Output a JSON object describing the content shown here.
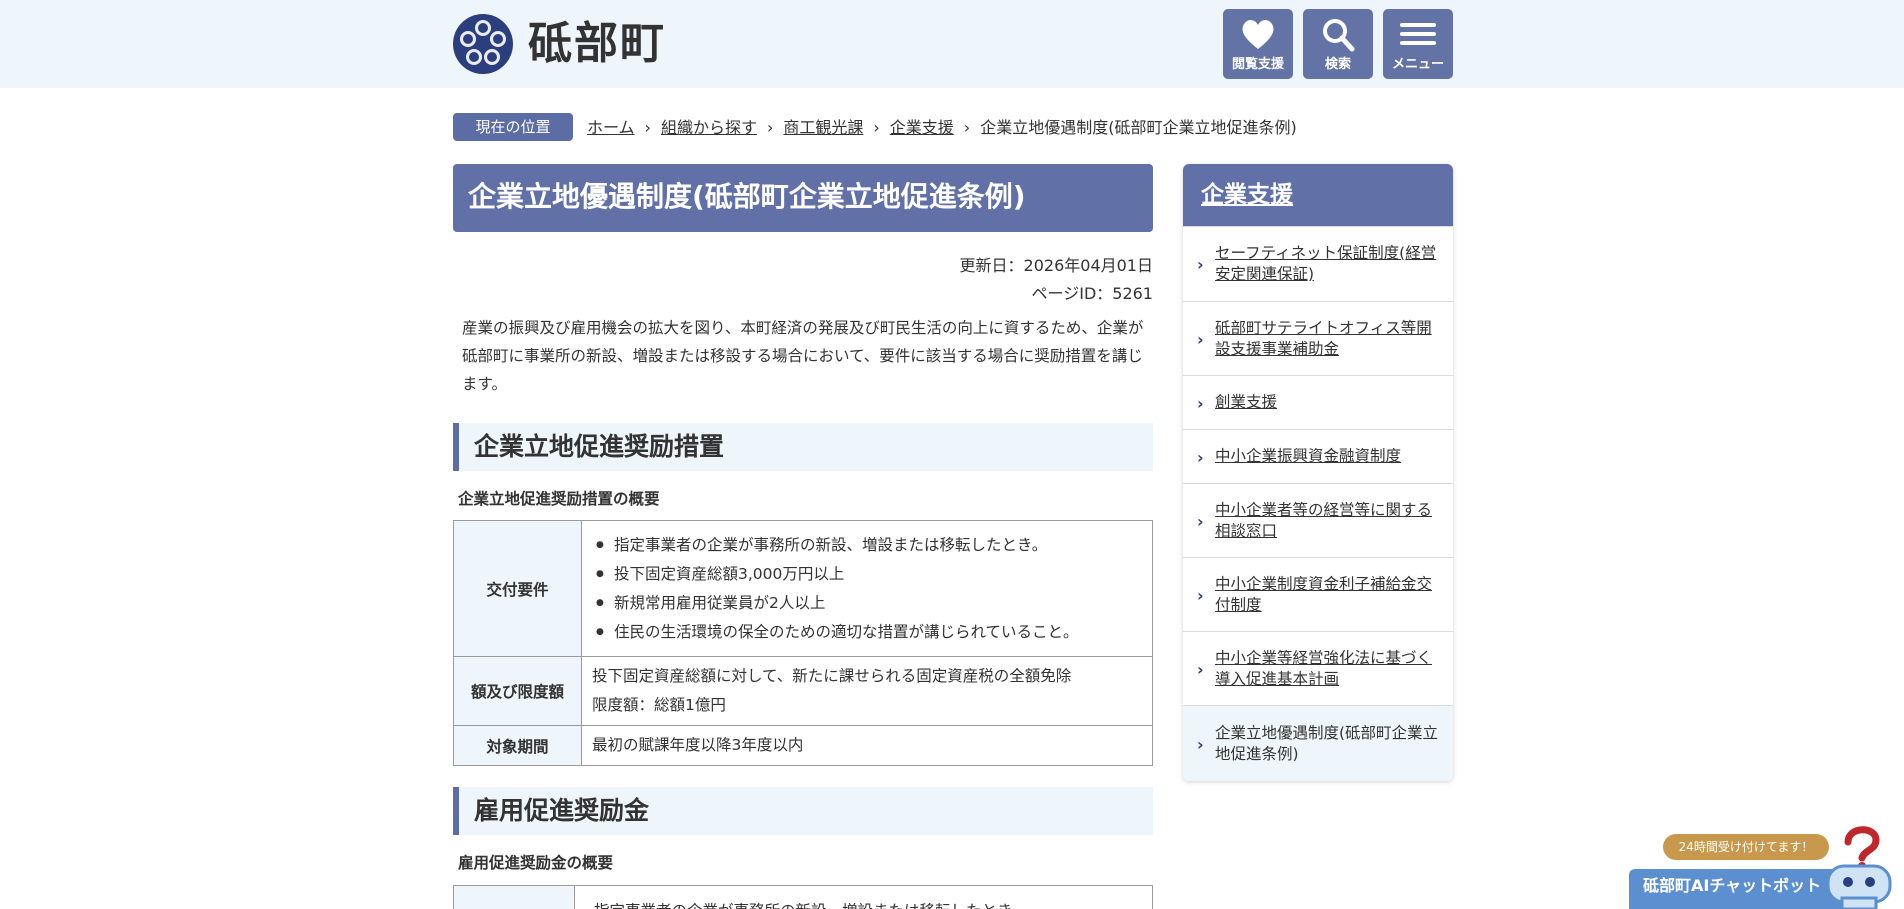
{
  "header": {
    "site_title": "砥部町",
    "buttons": [
      {
        "label": "閲覧支援",
        "icon": "heart-icon"
      },
      {
        "label": "検索",
        "icon": "search-icon"
      },
      {
        "label": "メニュー",
        "icon": "menu-icon"
      }
    ]
  },
  "breadcrumb": {
    "tag": "現在の位置",
    "items": [
      "ホーム",
      "組織から探す",
      "商工観光課",
      "企業支援"
    ],
    "current": "企業立地優遇制度(砥部町企業立地促進条例)",
    "separator": "›"
  },
  "main": {
    "title": "企業立地優遇制度(砥部町企業立地促進条例)",
    "updated": "更新日：2026年04月01日",
    "page_id": "ページID：5261",
    "intro": "産業の振興及び雇用機会の拡大を図り、本町経済の発展及び町民生活の向上に資するため、企業が砥部町に事業所の新設、増設または移設する場合において、要件に該当する場合に奨励措置を講じます。",
    "section1": {
      "heading": "企業立地促進奨励措置",
      "subheading": "企業立地促進奨励措置の概要",
      "rows": [
        {
          "label": "交付要件",
          "items": [
            "指定事業者の企業が事務所の新設、増設または移転したとき。",
            "投下固定資産総額3,000万円以上",
            "新規常用雇用従業員が2人以上",
            "住民の生活環境の保全のための適切な措置が講じられていること。"
          ]
        },
        {
          "label": "額及び限度額",
          "line1": "投下固定資産総額に対して、新たに課せられる固定資産税の全額免除",
          "line2": "限度額：総額1億円"
        },
        {
          "label": "対象期間",
          "line1": "最初の賦課年度以降3年度以内"
        }
      ]
    },
    "section2": {
      "heading": "雇用促進奨励金",
      "subheading": "雇用促進奨励金の概要",
      "first_line_partial": "指定事業者の企業が事務所の新設、増設または移転したとき。"
    }
  },
  "sidebar": {
    "heading": "企業支援",
    "items": [
      {
        "label": "セーフティネット保証制度(経営安定関連保証)"
      },
      {
        "label": "砥部町サテライトオフィス等開設支援事業補助金"
      },
      {
        "label": "創業支援"
      },
      {
        "label": "中小企業振興資金融資制度"
      },
      {
        "label": "中小企業者等の経営等に関する相談窓口"
      },
      {
        "label": "中小企業制度資金利子補給金交付制度"
      },
      {
        "label": "中小企業等経営強化法に基づく導入促進基本計画"
      },
      {
        "label": "企業立地優遇制度(砥部町企業立地促進条例)",
        "current": true
      }
    ]
  },
  "chatbot": {
    "bubble": "24時間受け付けてます！",
    "label": "砥部町AIチャットボット"
  },
  "colors": {
    "accent": "#6171a8",
    "header_bg": "#eef6fb",
    "logo": "#2b3f7e",
    "chat_bar": "#5b8fd0",
    "chat_bubble": "#c8994c"
  }
}
